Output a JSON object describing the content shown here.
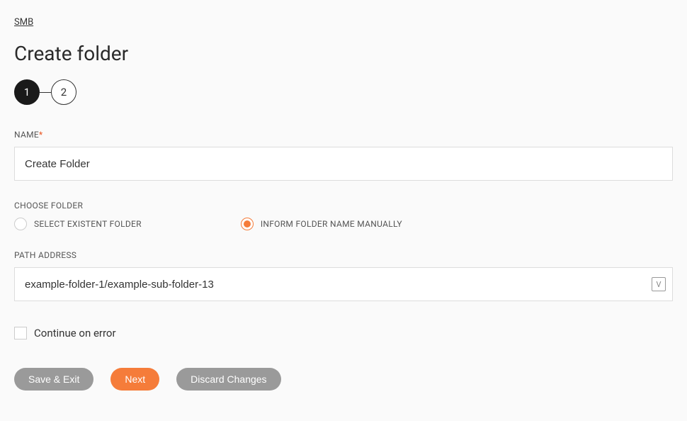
{
  "breadcrumb": "SMB",
  "page_title": "Create folder",
  "stepper": {
    "steps": [
      "1",
      "2"
    ],
    "active_index": 0
  },
  "form": {
    "name": {
      "label": "NAME",
      "required": true,
      "value": "Create Folder"
    },
    "choose_folder": {
      "label": "CHOOSE FOLDER",
      "options": [
        {
          "label": "SELECT EXISTENT FOLDER",
          "selected": false
        },
        {
          "label": "INFORM FOLDER NAME MANUALLY",
          "selected": true
        }
      ]
    },
    "path_address": {
      "label": "PATH ADDRESS",
      "value": "example-folder-1/example-sub-folder-13",
      "variable_icon": "V"
    },
    "continue_on_error": {
      "label": "Continue on error",
      "checked": false
    }
  },
  "buttons": {
    "save_exit": "Save & Exit",
    "next": "Next",
    "discard": "Discard Changes"
  }
}
